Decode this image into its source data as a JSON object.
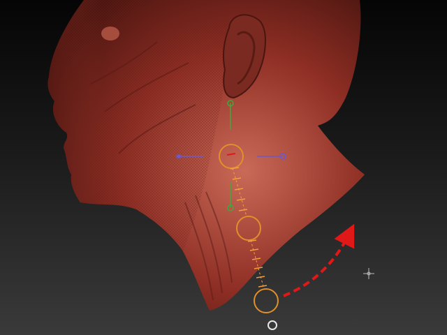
{
  "viewport": {
    "background_top": "#050505",
    "background_bottom": "#3a3a3a"
  },
  "model": {
    "kind": "sculpted human head and neck",
    "skin_color": "#8e2e24",
    "skin_highlight": "#c96a58",
    "skin_shadow": "#4a1510"
  },
  "gizmo": {
    "axis_y_color": "#3caa3c",
    "axis_x_color": "#6a5acd",
    "ring_color": "#e0902a",
    "tick_color": "#f0a040"
  },
  "annotation": {
    "arrow_color": "#e01818",
    "arrow_style": "dashed"
  },
  "icons": {
    "bottom_indicator": "circle-icon",
    "cursor": "crosshair-icon"
  }
}
